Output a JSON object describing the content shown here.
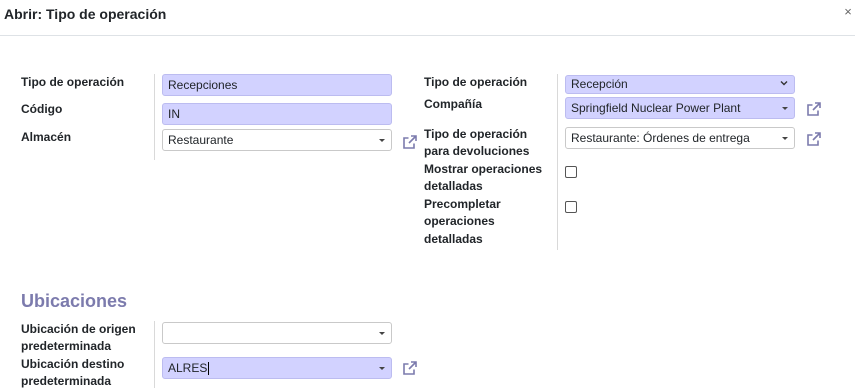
{
  "dialog": {
    "title": "Abrir: Tipo de operación",
    "close_glyph": "×"
  },
  "left": {
    "tipo_label": "Tipo de operación",
    "tipo_value": "Recepciones",
    "codigo_label": "Código",
    "codigo_value": "IN",
    "almacen_label": "Almacén",
    "almacen_value": "Restaurante"
  },
  "right": {
    "tipo_label": "Tipo de operación",
    "tipo_value": "Recepción",
    "compania_label": "Compañía",
    "compania_value": "Springfield Nuclear Power Plant",
    "devoluciones_label_1": "Tipo de operación",
    "devoluciones_label_2": "para devoluciones",
    "devoluciones_value": "Restaurante: Órdenes de entrega",
    "mostrar_label_1": "Mostrar operaciones",
    "mostrar_label_2": "detalladas",
    "mostrar_checked": false,
    "precompletar_label_1": "Precompletar",
    "precompletar_label_2": "operaciones",
    "precompletar_label_3": "detalladas",
    "precompletar_checked": false
  },
  "ubicaciones": {
    "section_title": "Ubicaciones",
    "origen_label_1": "Ubicación de origen",
    "origen_label_2": "predeterminada",
    "origen_value": "",
    "destino_label_1": "Ubicación destino",
    "destino_label_2": "predeterminada",
    "destino_value": "ALRES"
  },
  "icons": {
    "external_link": "external-link-icon",
    "dropdown": "caret-down-icon",
    "close": "close-icon"
  },
  "colors": {
    "required_bg": "#d2d2ff",
    "section_title": "#7c7bad",
    "link_icon": "#7c7bad"
  }
}
